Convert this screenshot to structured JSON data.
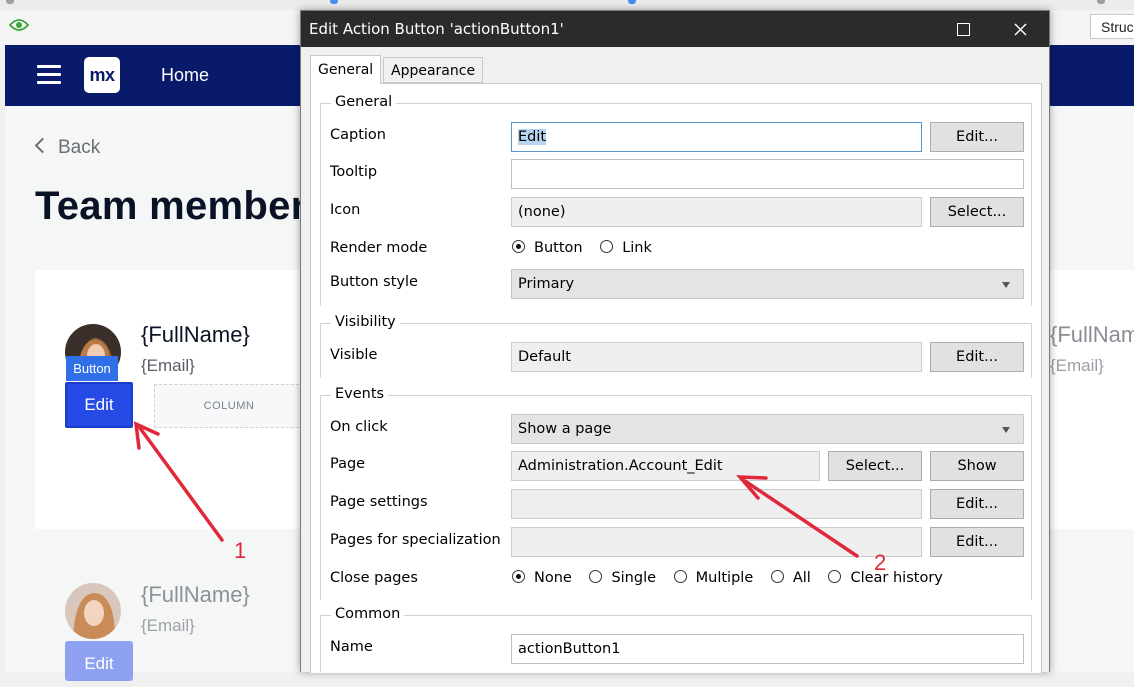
{
  "app": {
    "structure_tab": "Struc",
    "nav": {
      "logo": "mx",
      "home": "Home"
    },
    "back_label": "Back",
    "page_title": "Team members",
    "cards": [
      {
        "fullname": "{FullName}",
        "email": "{Email}",
        "button_tag": "Button",
        "edit_label": "Edit",
        "column_label": "COLUMN"
      },
      {
        "fullname": "{FullName}",
        "email": "{Email}",
        "edit_label": "Edit"
      }
    ],
    "right_card": {
      "fullname": "{FullName}",
      "email": "{Email}"
    }
  },
  "annotations": {
    "arrow1_label": "1",
    "arrow2_label": "2",
    "color": "#e0283a"
  },
  "dialog": {
    "title": "Edit Action Button 'actionButton1'",
    "tabs": [
      {
        "label": "General"
      },
      {
        "label": "Appearance"
      }
    ],
    "groups": {
      "general": {
        "title": "General",
        "caption": {
          "label": "Caption",
          "value": "Edit",
          "button": "Edit..."
        },
        "tooltip": {
          "label": "Tooltip",
          "value": ""
        },
        "icon": {
          "label": "Icon",
          "value": "(none)",
          "button": "Select..."
        },
        "render_mode": {
          "label": "Render mode",
          "options": [
            "Button",
            "Link"
          ],
          "selected": "Button"
        },
        "button_style": {
          "label": "Button style",
          "value": "Primary"
        }
      },
      "visibility": {
        "title": "Visibility",
        "visible": {
          "label": "Visible",
          "value": "Default",
          "button": "Edit..."
        }
      },
      "events": {
        "title": "Events",
        "on_click": {
          "label": "On click",
          "value": "Show a page"
        },
        "page": {
          "label": "Page",
          "value": "Administration.Account_Edit",
          "select_button": "Select...",
          "show_button": "Show"
        },
        "page_settings": {
          "label": "Page settings",
          "value": "",
          "button": "Edit..."
        },
        "pages_for_specialization": {
          "label": "Pages for specialization",
          "value": "",
          "button": "Edit..."
        },
        "close_pages": {
          "label": "Close pages",
          "options": [
            "None",
            "Single",
            "Multiple",
            "All",
            "Clear history"
          ],
          "selected": "None"
        }
      },
      "common": {
        "title": "Common",
        "name": {
          "label": "Name",
          "value": "actionButton1"
        }
      }
    }
  }
}
